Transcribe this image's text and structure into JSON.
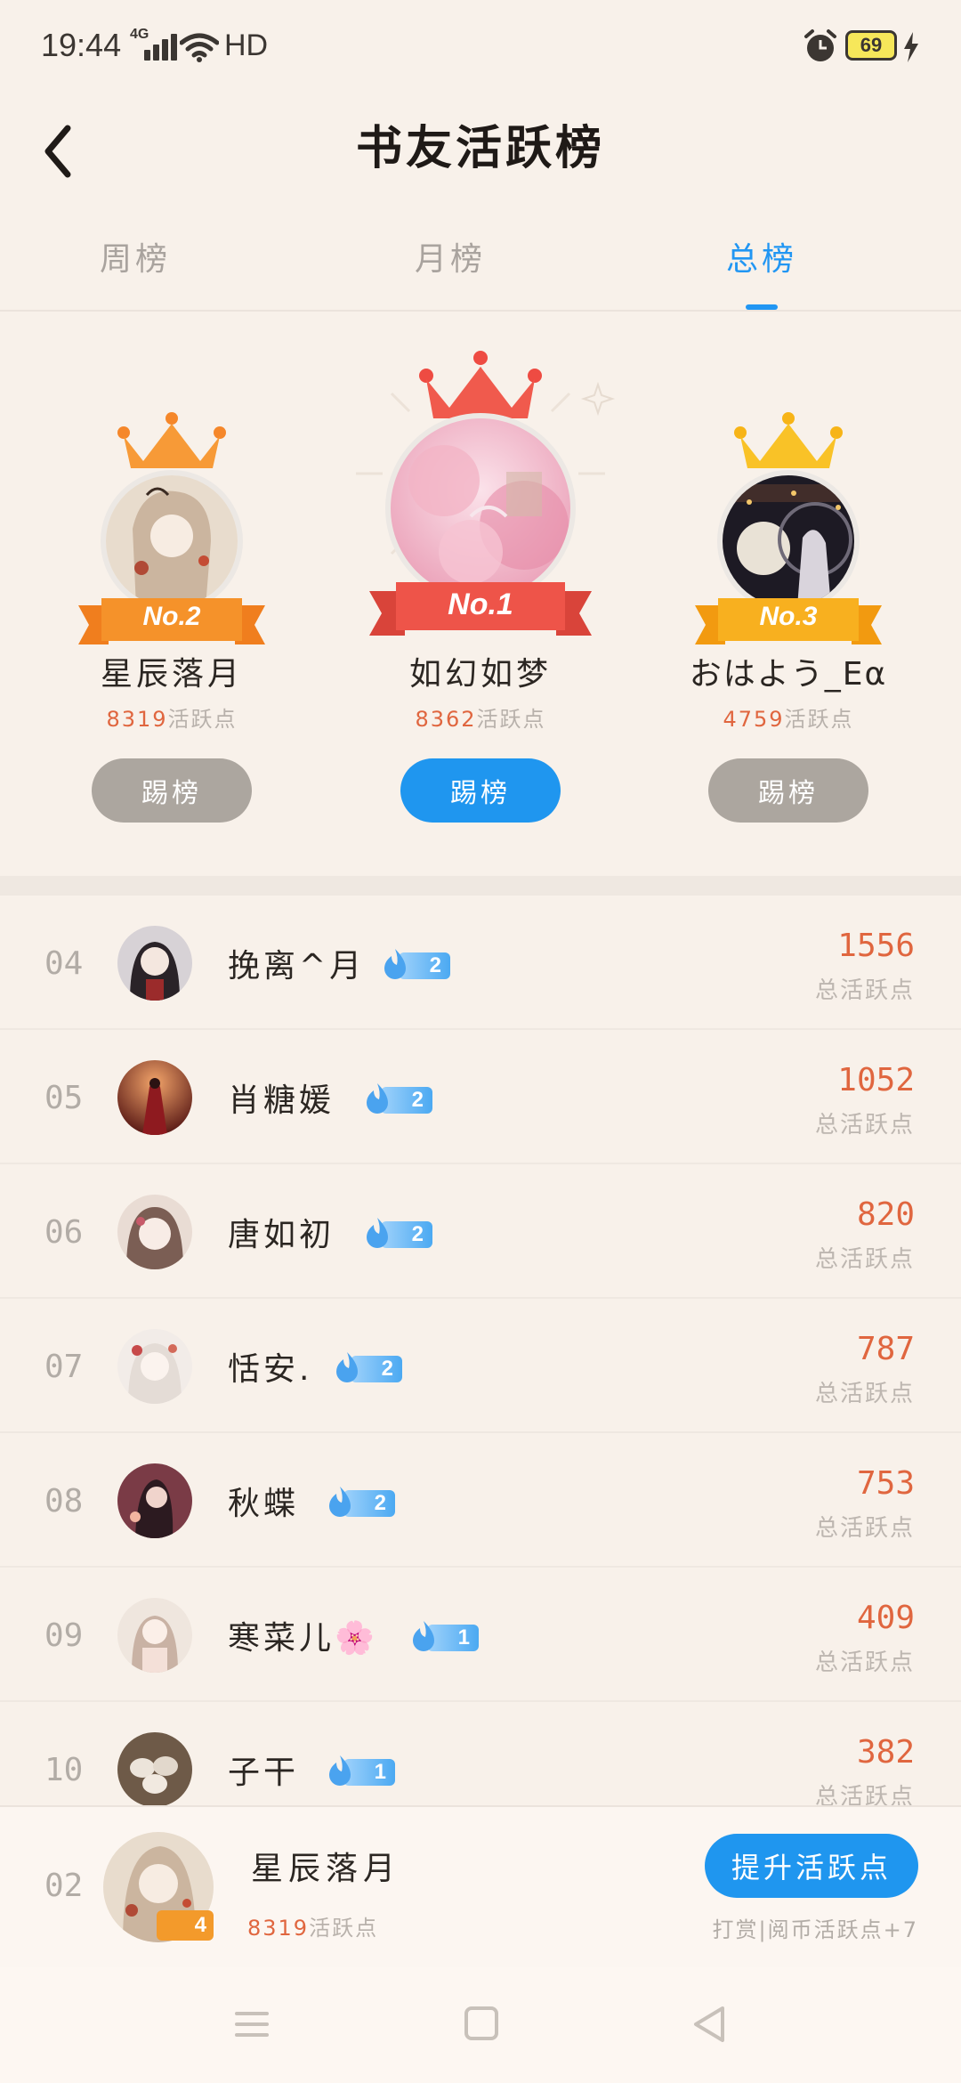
{
  "status_bar": {
    "time": "19:44",
    "network": "4G",
    "signal": "HD",
    "battery": "69"
  },
  "header": {
    "title": "书友活跃榜"
  },
  "tabs": [
    {
      "label": "周榜",
      "active": false
    },
    {
      "label": "月榜",
      "active": false
    },
    {
      "label": "总榜",
      "active": true
    }
  ],
  "podium": {
    "first": {
      "badge": "No.1",
      "name": "如幻如梦",
      "points": "8362",
      "points_unit": "活跃点",
      "button": "踢榜"
    },
    "second": {
      "badge": "No.2",
      "name": "星辰落月",
      "points": "8319",
      "points_unit": "活跃点",
      "button": "踢榜"
    },
    "third": {
      "badge": "No.3",
      "name": "おはよう_Eα",
      "points": "4759",
      "points_unit": "活跃点",
      "button": "踢榜"
    }
  },
  "list_score_label": "总活跃点",
  "rankings": [
    {
      "rank": "04",
      "name": "挽离^月",
      "level": "2",
      "score": "1556",
      "score_label": "总活跃点"
    },
    {
      "rank": "05",
      "name": "肖糖媛",
      "level": "2",
      "score": "1052",
      "score_label": "总活跃点"
    },
    {
      "rank": "06",
      "name": "唐如初",
      "level": "2",
      "score": "820",
      "score_label": "总活跃点"
    },
    {
      "rank": "07",
      "name": "恬安.",
      "level": "2",
      "score": "787",
      "score_label": "总活跃点"
    },
    {
      "rank": "08",
      "name": "秋蝶",
      "level": "2",
      "score": "753",
      "score_label": "总活跃点"
    },
    {
      "rank": "09",
      "name": "寒菜儿🌸",
      "level": "1",
      "score": "409",
      "score_label": "总活跃点"
    },
    {
      "rank": "10",
      "name": "子干",
      "level": "1",
      "score": "382",
      "score_label": "总活跃点"
    }
  ],
  "my_rank": {
    "rank": "02",
    "name": "星辰落月",
    "level": "4",
    "points": "8319",
    "points_unit": "活跃点",
    "button": "提升活跃点",
    "hint": "打赏|阅币活跃点+7"
  },
  "colors": {
    "accent": "#1f96ef",
    "score": "#e0663f",
    "background": "#f8f1ea"
  },
  "icons": {
    "back": "chevron-left-icon",
    "crown": "crown-icon",
    "level": "flame-icon"
  }
}
